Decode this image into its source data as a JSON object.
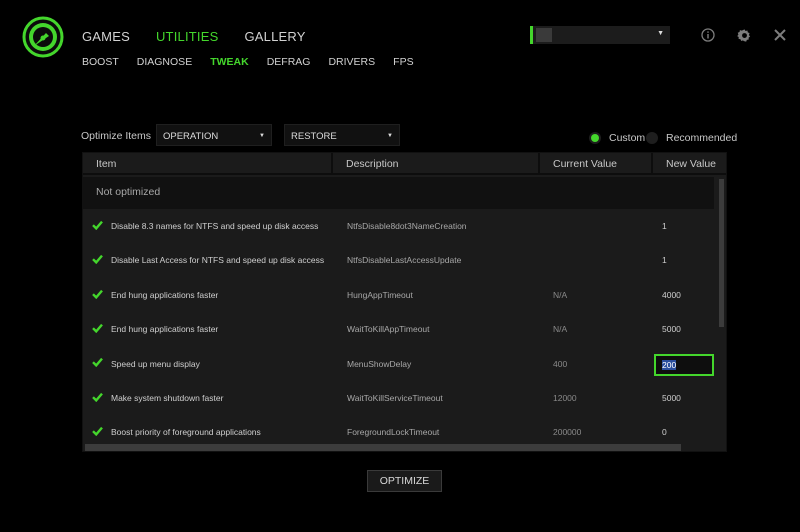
{
  "accent_color": "#44d62c",
  "nav": {
    "tabs": [
      {
        "label": "GAMES",
        "active": false
      },
      {
        "label": "UTILITIES",
        "active": true
      },
      {
        "label": "GALLERY",
        "active": false
      }
    ],
    "subtabs": [
      {
        "label": "BOOST",
        "active": false
      },
      {
        "label": "DIAGNOSE",
        "active": false
      },
      {
        "label": "TWEAK",
        "active": true
      },
      {
        "label": "DEFRAG",
        "active": false
      },
      {
        "label": "DRIVERS",
        "active": false
      },
      {
        "label": "FPS",
        "active": false
      }
    ]
  },
  "header_icons": [
    "info-icon",
    "gear-icon",
    "close-icon"
  ],
  "toolbar": {
    "optimize_items_label": "Optimize Items",
    "operation_value": "OPERATION",
    "restore_value": "RESTORE",
    "radio_custom": "Custom",
    "radio_recommended": "Recommended",
    "selected_mode": "Custom"
  },
  "table": {
    "columns": [
      "Item",
      "Description",
      "Current Value",
      "New Value"
    ],
    "group_label": "Not optimized",
    "rows": [
      {
        "item": "Disable 8.3 names for NTFS and speed up disk access",
        "description": "NtfsDisable8dot3NameCreation",
        "current": "",
        "new": "1"
      },
      {
        "item": "Disable Last Access for NTFS and speed up disk access",
        "description": "NtfsDisableLastAccessUpdate",
        "current": "",
        "new": "1"
      },
      {
        "item": "End hung applications faster",
        "description": "HungAppTimeout",
        "current": "N/A",
        "new": "4000"
      },
      {
        "item": "End hung applications faster",
        "description": "WaitToKillAppTimeout",
        "current": "N/A",
        "new": "5000"
      },
      {
        "item": "Speed up menu display",
        "description": "MenuShowDelay",
        "current": "400",
        "new": "200"
      },
      {
        "item": "Make system shutdown faster",
        "description": "WaitToKillServiceTimeout",
        "current": "12000",
        "new": "5000"
      },
      {
        "item": "Boost priority of foreground applications",
        "description": "ForegroundLockTimeout",
        "current": "200000",
        "new": "0"
      }
    ]
  },
  "actions": {
    "optimize_label": "OPTIMIZE"
  }
}
